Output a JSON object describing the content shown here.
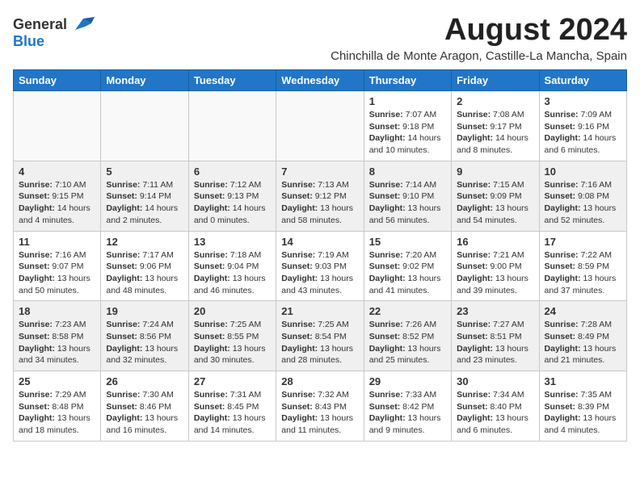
{
  "logo": {
    "general": "General",
    "blue": "Blue"
  },
  "title": "August 2024",
  "subtitle": "Chinchilla de Monte Aragon, Castille-La Mancha, Spain",
  "days_header": [
    "Sunday",
    "Monday",
    "Tuesday",
    "Wednesday",
    "Thursday",
    "Friday",
    "Saturday"
  ],
  "weeks": [
    [
      {
        "day": "",
        "info": ""
      },
      {
        "day": "",
        "info": ""
      },
      {
        "day": "",
        "info": ""
      },
      {
        "day": "",
        "info": ""
      },
      {
        "day": "1",
        "info": "Sunrise: 7:07 AM\nSunset: 9:18 PM\nDaylight: 14 hours and 10 minutes."
      },
      {
        "day": "2",
        "info": "Sunrise: 7:08 AM\nSunset: 9:17 PM\nDaylight: 14 hours and 8 minutes."
      },
      {
        "day": "3",
        "info": "Sunrise: 7:09 AM\nSunset: 9:16 PM\nDaylight: 14 hours and 6 minutes."
      }
    ],
    [
      {
        "day": "4",
        "info": "Sunrise: 7:10 AM\nSunset: 9:15 PM\nDaylight: 14 hours and 4 minutes."
      },
      {
        "day": "5",
        "info": "Sunrise: 7:11 AM\nSunset: 9:14 PM\nDaylight: 14 hours and 2 minutes."
      },
      {
        "day": "6",
        "info": "Sunrise: 7:12 AM\nSunset: 9:13 PM\nDaylight: 14 hours and 0 minutes."
      },
      {
        "day": "7",
        "info": "Sunrise: 7:13 AM\nSunset: 9:12 PM\nDaylight: 13 hours and 58 minutes."
      },
      {
        "day": "8",
        "info": "Sunrise: 7:14 AM\nSunset: 9:10 PM\nDaylight: 13 hours and 56 minutes."
      },
      {
        "day": "9",
        "info": "Sunrise: 7:15 AM\nSunset: 9:09 PM\nDaylight: 13 hours and 54 minutes."
      },
      {
        "day": "10",
        "info": "Sunrise: 7:16 AM\nSunset: 9:08 PM\nDaylight: 13 hours and 52 minutes."
      }
    ],
    [
      {
        "day": "11",
        "info": "Sunrise: 7:16 AM\nSunset: 9:07 PM\nDaylight: 13 hours and 50 minutes."
      },
      {
        "day": "12",
        "info": "Sunrise: 7:17 AM\nSunset: 9:06 PM\nDaylight: 13 hours and 48 minutes."
      },
      {
        "day": "13",
        "info": "Sunrise: 7:18 AM\nSunset: 9:04 PM\nDaylight: 13 hours and 46 minutes."
      },
      {
        "day": "14",
        "info": "Sunrise: 7:19 AM\nSunset: 9:03 PM\nDaylight: 13 hours and 43 minutes."
      },
      {
        "day": "15",
        "info": "Sunrise: 7:20 AM\nSunset: 9:02 PM\nDaylight: 13 hours and 41 minutes."
      },
      {
        "day": "16",
        "info": "Sunrise: 7:21 AM\nSunset: 9:00 PM\nDaylight: 13 hours and 39 minutes."
      },
      {
        "day": "17",
        "info": "Sunrise: 7:22 AM\nSunset: 8:59 PM\nDaylight: 13 hours and 37 minutes."
      }
    ],
    [
      {
        "day": "18",
        "info": "Sunrise: 7:23 AM\nSunset: 8:58 PM\nDaylight: 13 hours and 34 minutes."
      },
      {
        "day": "19",
        "info": "Sunrise: 7:24 AM\nSunset: 8:56 PM\nDaylight: 13 hours and 32 minutes."
      },
      {
        "day": "20",
        "info": "Sunrise: 7:25 AM\nSunset: 8:55 PM\nDaylight: 13 hours and 30 minutes."
      },
      {
        "day": "21",
        "info": "Sunrise: 7:25 AM\nSunset: 8:54 PM\nDaylight: 13 hours and 28 minutes."
      },
      {
        "day": "22",
        "info": "Sunrise: 7:26 AM\nSunset: 8:52 PM\nDaylight: 13 hours and 25 minutes."
      },
      {
        "day": "23",
        "info": "Sunrise: 7:27 AM\nSunset: 8:51 PM\nDaylight: 13 hours and 23 minutes."
      },
      {
        "day": "24",
        "info": "Sunrise: 7:28 AM\nSunset: 8:49 PM\nDaylight: 13 hours and 21 minutes."
      }
    ],
    [
      {
        "day": "25",
        "info": "Sunrise: 7:29 AM\nSunset: 8:48 PM\nDaylight: 13 hours and 18 minutes."
      },
      {
        "day": "26",
        "info": "Sunrise: 7:30 AM\nSunset: 8:46 PM\nDaylight: 13 hours and 16 minutes."
      },
      {
        "day": "27",
        "info": "Sunrise: 7:31 AM\nSunset: 8:45 PM\nDaylight: 13 hours and 14 minutes."
      },
      {
        "day": "28",
        "info": "Sunrise: 7:32 AM\nSunset: 8:43 PM\nDaylight: 13 hours and 11 minutes."
      },
      {
        "day": "29",
        "info": "Sunrise: 7:33 AM\nSunset: 8:42 PM\nDaylight: 13 hours and 9 minutes."
      },
      {
        "day": "30",
        "info": "Sunrise: 7:34 AM\nSunset: 8:40 PM\nDaylight: 13 hours and 6 minutes."
      },
      {
        "day": "31",
        "info": "Sunrise: 7:35 AM\nSunset: 8:39 PM\nDaylight: 13 hours and 4 minutes."
      }
    ]
  ]
}
